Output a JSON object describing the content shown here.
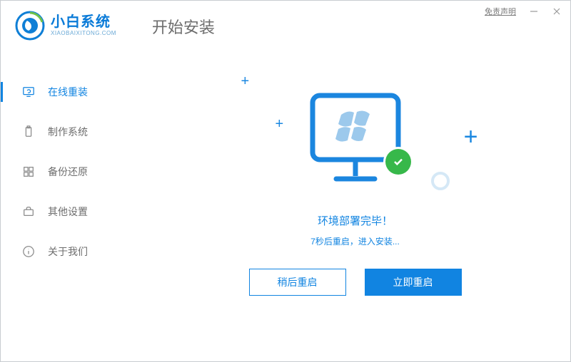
{
  "titlebar": {
    "disclaimer": "免责声明"
  },
  "brand": {
    "name": "小白系统",
    "domain": "XIAOBAIXITONG.COM"
  },
  "page_title": "开始安装",
  "sidebar": {
    "items": [
      {
        "label": "在线重装"
      },
      {
        "label": "制作系统"
      },
      {
        "label": "备份还原"
      },
      {
        "label": "其他设置"
      },
      {
        "label": "关于我们"
      }
    ]
  },
  "main": {
    "status": "环境部署完毕！",
    "substatus": "7秒后重启，进入安装...",
    "later_label": "稍后重启",
    "now_label": "立即重启"
  }
}
